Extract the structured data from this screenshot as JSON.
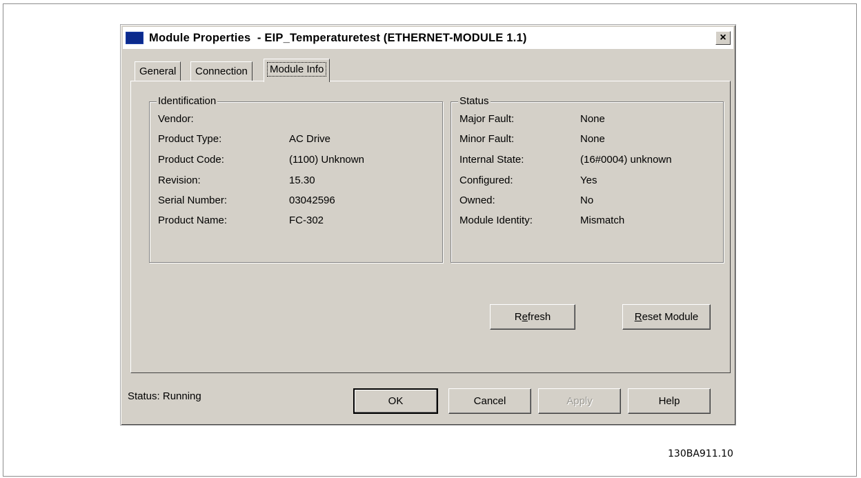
{
  "dialog": {
    "title": "Module Properties  - EIP_Temperaturetest (ETHERNET-MODULE 1.1)",
    "close_label": "×"
  },
  "tabs": [
    {
      "label": "General"
    },
    {
      "label": "Connection"
    },
    {
      "label": "Module Info"
    }
  ],
  "identification": {
    "title": "Identification",
    "rows": [
      {
        "label": "Vendor:",
        "value": ""
      },
      {
        "label": "Product Type:",
        "value": "AC Drive"
      },
      {
        "label": "Product Code:",
        "value": "(1100) Unknown"
      },
      {
        "label": "Revision:",
        "value": "15.30"
      },
      {
        "label": "Serial Number:",
        "value": "03042596"
      },
      {
        "label": "Product Name:",
        "value": "FC-302"
      }
    ]
  },
  "status_group": {
    "title": "Status",
    "rows": [
      {
        "label": "Major Fault:",
        "value": "None"
      },
      {
        "label": "Minor Fault:",
        "value": "None"
      },
      {
        "label": "Internal State:",
        "value": "(16#0004) unknown"
      },
      {
        "label": "Configured:",
        "value": "Yes"
      },
      {
        "label": "Owned:",
        "value": "No"
      },
      {
        "label": "Module Identity:",
        "value": "Mismatch"
      }
    ]
  },
  "buttons": {
    "refresh_pre": "R",
    "refresh_u": "e",
    "refresh_post": "fresh",
    "reset_u": "R",
    "reset_post": "eset Module",
    "ok": "OK",
    "cancel": "Cancel",
    "apply": "Apply",
    "help": "Help"
  },
  "statusbar": {
    "text": "Status:  Running"
  },
  "figure_code": "130BA911.10"
}
